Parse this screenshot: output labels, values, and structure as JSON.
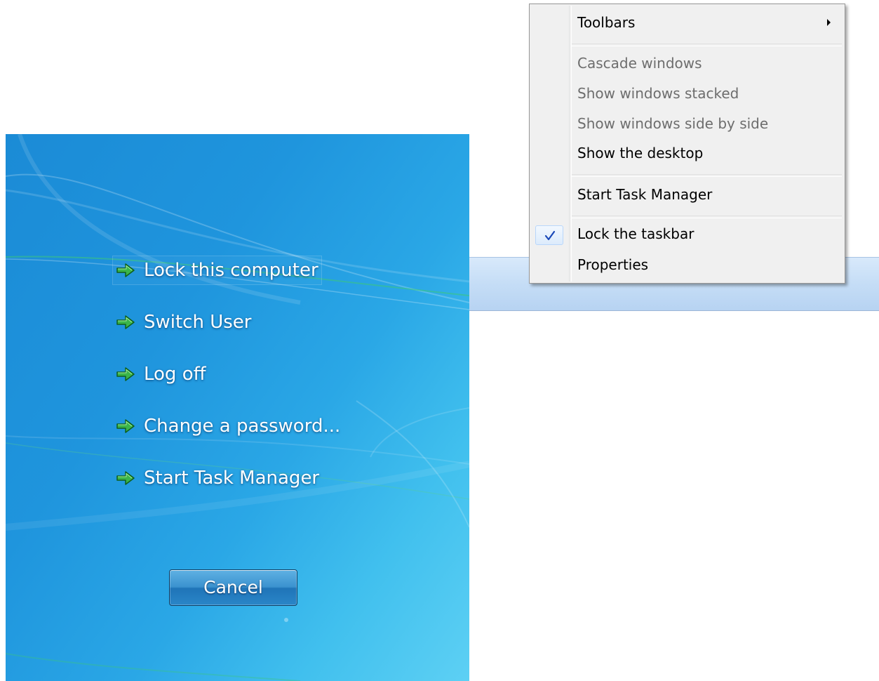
{
  "security_screen": {
    "options": [
      {
        "label": "Lock this computer",
        "icon": "green-arrow-icon"
      },
      {
        "label": "Switch User",
        "icon": "green-arrow-icon"
      },
      {
        "label": "Log off",
        "icon": "green-arrow-icon"
      },
      {
        "label": "Change a password...",
        "icon": "green-arrow-icon"
      },
      {
        "label": "Start Task Manager",
        "icon": "green-arrow-icon"
      }
    ],
    "cancel_label": "Cancel",
    "colors": {
      "background_start": "#1b8bd6",
      "background_end": "#5dd0f4",
      "arrow": "#3bb54a"
    }
  },
  "context_menu": {
    "items": [
      {
        "label": "Toolbars",
        "enabled": true,
        "submenu": true
      },
      {
        "label": "Cascade windows",
        "enabled": false
      },
      {
        "label": "Show windows stacked",
        "enabled": false
      },
      {
        "label": "Show windows side by side",
        "enabled": false
      },
      {
        "label": "Show the desktop",
        "enabled": true
      },
      {
        "label": "Start Task Manager",
        "enabled": true
      },
      {
        "label": "Lock the taskbar",
        "enabled": true,
        "checked": true,
        "icon": "checkmark-icon"
      },
      {
        "label": "Properties",
        "enabled": true
      }
    ],
    "colors": {
      "checkmark": "#1a48b8",
      "disabled_text": "#6d6d6d"
    }
  }
}
